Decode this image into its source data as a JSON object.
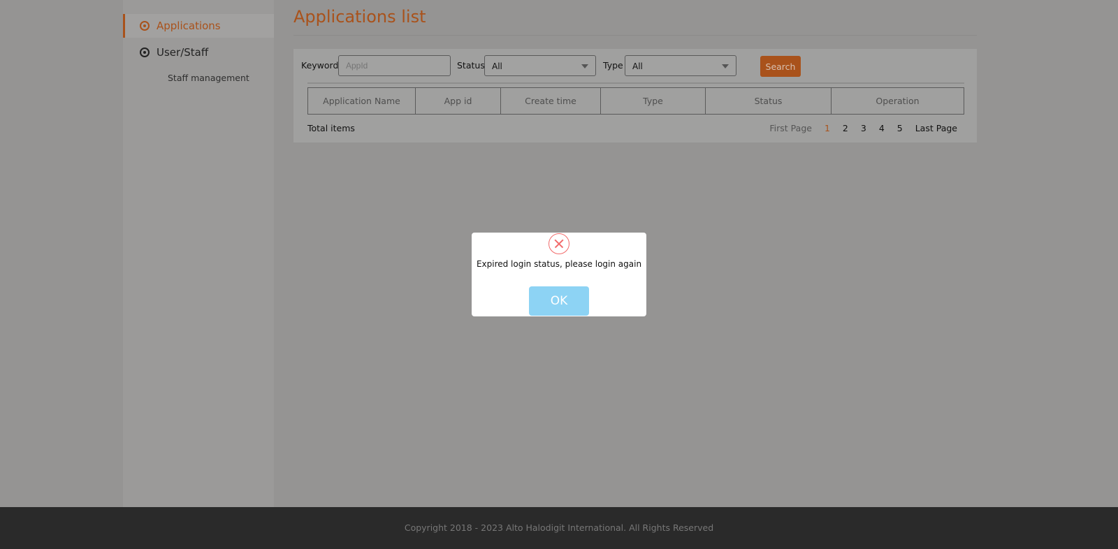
{
  "sidebar": {
    "items": [
      {
        "label": "Applications",
        "icon": "applications-icon",
        "active": true
      },
      {
        "label": "User/Staff",
        "icon": "user-staff-icon"
      }
    ],
    "sub_items": [
      "Staff management"
    ]
  },
  "page": {
    "title": "Applications list"
  },
  "filters": {
    "keyword_label": "Keyword",
    "keyword_placeholder": "AppId",
    "status_label": "Status",
    "status_value": "All",
    "type_label": "Type",
    "type_value": "All",
    "search_label": "Search"
  },
  "table": {
    "columns": [
      "Application Name",
      "App id",
      "Create time",
      "Type",
      "Status",
      "Operation"
    ]
  },
  "footer_bar": {
    "total_label": "Total items",
    "pagination": {
      "first": "First Page",
      "pages": [
        "1",
        "2",
        "3",
        "4",
        "5"
      ],
      "current": "1",
      "last": "Last Page"
    }
  },
  "footer": {
    "copyright": "Copyright 2018 - 2023 Alto Halodigit International. All Rights Reserved"
  },
  "dialog": {
    "icon": "error-x-icon",
    "message": "Expired login status, please login again",
    "ok_label": "OK"
  },
  "colors": {
    "accent": "#a9521b",
    "ok_button": "#8dd3f4",
    "error": "#f26b6b"
  }
}
